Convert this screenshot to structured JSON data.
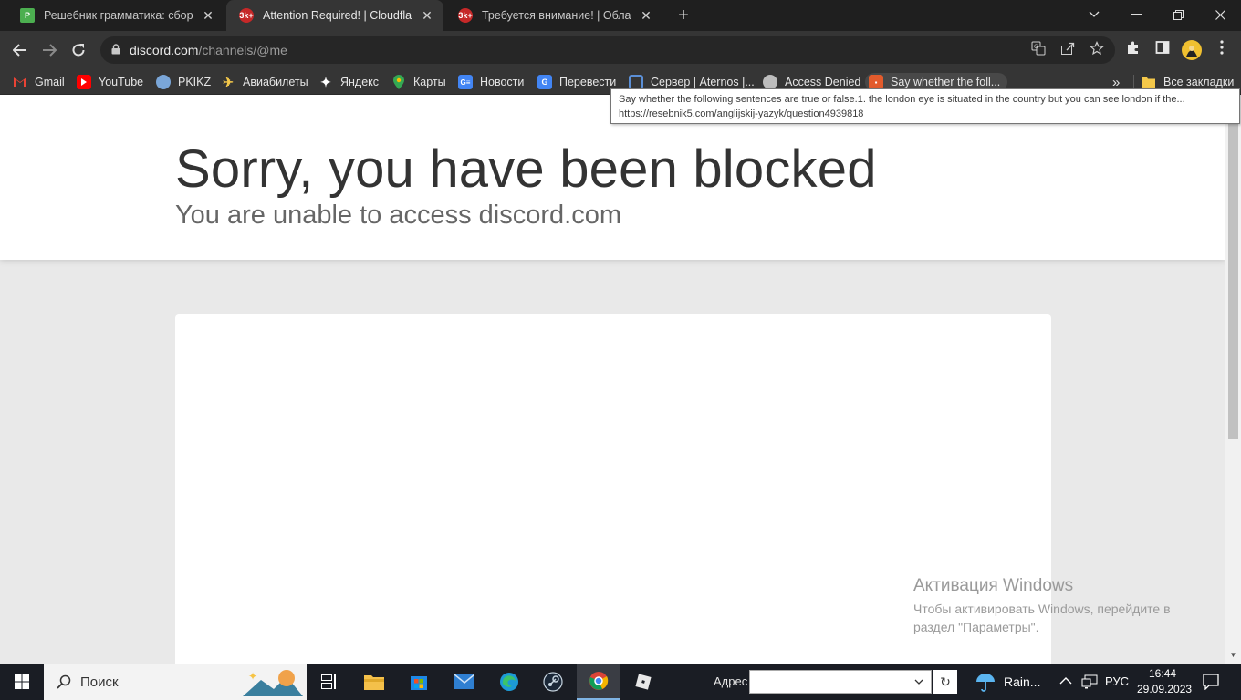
{
  "tabs": [
    {
      "title": "Решебник грамматика: сборник",
      "favicon": "P"
    },
    {
      "title": "Attention Required! | Cloudflare",
      "favicon": "3k+"
    },
    {
      "title": "Требуется внимание! | Облачн",
      "favicon": "3k+"
    }
  ],
  "address": {
    "host": "discord.com",
    "path": "/channels/@me"
  },
  "bookmarks": [
    {
      "label": "Gmail",
      "icon": "gmail-icon"
    },
    {
      "label": "YouTube",
      "icon": "youtube-icon"
    },
    {
      "label": "PKIKZ",
      "icon": "globe-icon"
    },
    {
      "label": "Авиабилеты",
      "icon": "plane-icon"
    },
    {
      "label": "Яндекс",
      "icon": "yandex-icon"
    },
    {
      "label": "Карты",
      "icon": "maps-icon"
    },
    {
      "label": "Новости",
      "icon": "news-icon"
    },
    {
      "label": "Перевести",
      "icon": "translate-icon"
    },
    {
      "label": "Сервер | Aternos |...",
      "icon": "aternos-icon"
    },
    {
      "label": "Access Denied",
      "icon": "globe-icon"
    },
    {
      "label": "Say whether the foll...",
      "icon": "resebnik-icon"
    }
  ],
  "bookmarks_more": "»",
  "all_bookmarks": "Все закладки",
  "tooltip": {
    "line1": "Say whether the following sentences are true or false.1. the london eye is situated in the country but you can see london if the...",
    "line2": "https://resebnik5.com/anglijskij-yazyk/question4939818"
  },
  "page": {
    "heading": "Sorry, you have been blocked",
    "subheading": "You are unable to access discord.com"
  },
  "activation": {
    "title": "Активация Windows",
    "line1": "Чтобы активировать Windows, перейдите в",
    "line2": "раздел \"Параметры\"."
  },
  "taskbar": {
    "search_label": "Поиск",
    "address_label": "Адрес",
    "weather": "Rain...",
    "language": "РУС",
    "time": "16:44",
    "date": "29.09.2023"
  }
}
